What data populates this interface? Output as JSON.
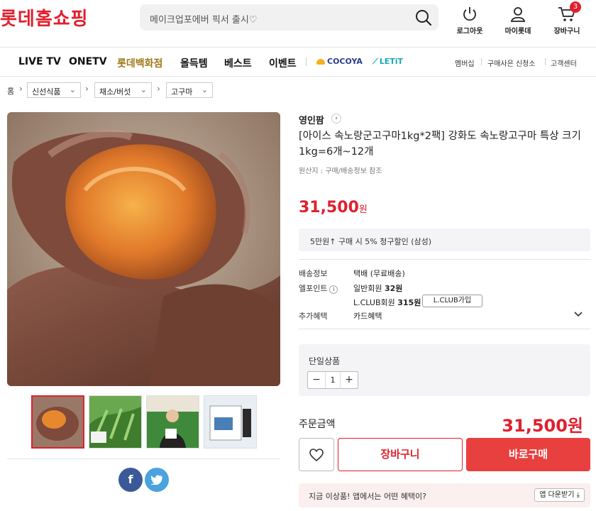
{
  "header": {
    "logo": "롯데홈쇼핑",
    "search_placeholder": "메이크업포에버 픽서 출시♡",
    "logout_label": "로그아웃",
    "mypage_label": "마이롯데",
    "cart_label": "장바구니",
    "cart_count": "3"
  },
  "nav": {
    "items": [
      "LIVE TV",
      "ONETV",
      "롯데백화점",
      "올득템",
      "베스트",
      "이벤트"
    ],
    "brands": [
      "COCOYA",
      "LETiT"
    ],
    "util": [
      "멤버십",
      "구매사은 신청소",
      "고객센터"
    ]
  },
  "breadcrumb": {
    "home": "홈",
    "levels": [
      "신선식품",
      "채소/버섯",
      "고구마"
    ]
  },
  "product": {
    "seller": "영인팜",
    "title": "[아이스 속노랑군고구마1kg*2팩] 강화도 속노랑고구마 특상 크기 1kg=6개~12개",
    "origin": "원산지 : 구매/배송정보 참조",
    "price": "31,500",
    "price_unit": "원",
    "promo": "5만원↑ 구매 시 5% 청구할인 (삼성)",
    "shipping_label": "배송정보",
    "shipping_value": "택배 (무료배송)",
    "points_label": "엘포인트",
    "points_regular_label": "일반회원",
    "points_regular_value": "32원",
    "points_lclub_label": "L.CLUB회원",
    "points_lclub_value": "315원",
    "lclub_button": "L.CLUB가입",
    "benefit_label": "추가혜택",
    "benefit_value": "카드혜택",
    "option_label": "단일상품",
    "quantity": "1",
    "order_label": "주문금액",
    "order_total": "31,500원",
    "cart_button": "장바구니",
    "buy_button": "바로구매",
    "app_text": "지금 이상품! 앱에서는 어떤 혜택이?",
    "app_button": "앱 다운받기 ⤓"
  },
  "colors": {
    "brand_red": "#e0202d",
    "buy_red": "#e8403e",
    "facebook": "#3b5998",
    "twitter": "#4aa3df"
  }
}
